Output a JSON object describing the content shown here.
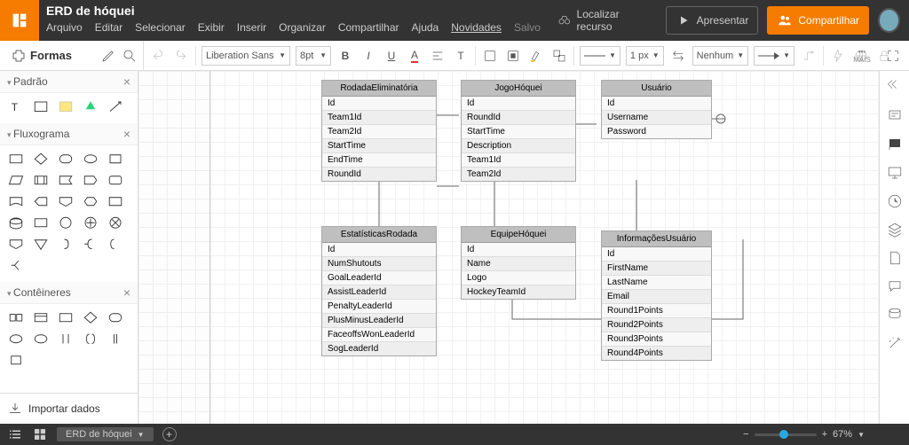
{
  "doc_title": "ERD de hóquei",
  "menus": [
    "Arquivo",
    "Editar",
    "Selecionar",
    "Exibir",
    "Inserir",
    "Organizar",
    "Compartilhar",
    "Ajuda",
    "Novidades"
  ],
  "saved": "Salvo",
  "find": "Localizar recurso",
  "present": "Apresentar",
  "share": "Compartilhar",
  "shapes_label": "Formas",
  "font": "Liberation Sans",
  "ptsize": "8pt",
  "line_px": "1 px",
  "fill_none": "Nenhum",
  "sections": {
    "padrao": "Padrão",
    "fluxo": "Fluxograma",
    "cont": "Contêineres"
  },
  "import": "Importar dados",
  "page_tab": "ERD de hóquei",
  "zoom": "67%",
  "mais": "MAIS",
  "entities": {
    "rodada": {
      "title": "RodadaEliminatória",
      "fields": [
        "Id",
        "Team1Id",
        "Team2Id",
        "StartTime",
        "EndTime",
        "RoundId"
      ]
    },
    "jogo": {
      "title": "JogoHóquei",
      "fields": [
        "Id",
        "RoundId",
        "StartTime",
        "Description",
        "Team1Id",
        "Team2Id"
      ]
    },
    "user": {
      "title": "Usuário",
      "fields": [
        "Id",
        "Username",
        "Password"
      ]
    },
    "stats": {
      "title": "EstatísticasRodada",
      "fields": [
        "Id",
        "NumShutouts",
        "GoalLeaderId",
        "AssistLeaderId",
        "PenaltyLeaderId",
        "PlusMinusLeaderId",
        "FaceoffsWonLeaderId",
        "SogLeaderId"
      ]
    },
    "equipe": {
      "title": "EquipeHóquei",
      "fields": [
        "Id",
        "Name",
        "Logo",
        "HockeyTeamId"
      ]
    },
    "info": {
      "title": "InformaçõesUsuário",
      "fields": [
        "Id",
        "FirstName",
        "LastName",
        "Email",
        "Round1Points",
        "Round2Points",
        "Round3Points",
        "Round4Points"
      ]
    }
  }
}
